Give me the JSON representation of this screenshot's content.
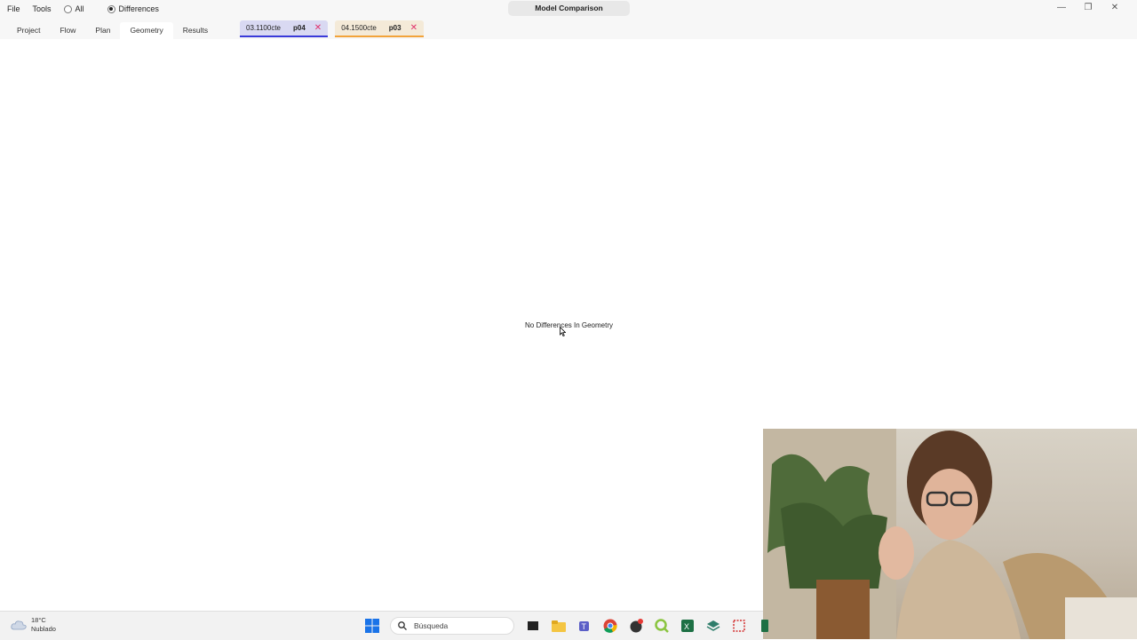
{
  "window": {
    "title": "Model Comparison",
    "controls": {
      "minimize": "—",
      "restore": "❐",
      "close": "✕"
    }
  },
  "menu": {
    "file": "File",
    "tools": "Tools"
  },
  "filter": {
    "all_label": "All",
    "differences_label": "Differences",
    "selected": "Differences"
  },
  "tabs": [
    {
      "label": "Project"
    },
    {
      "label": "Flow"
    },
    {
      "label": "Plan"
    },
    {
      "label": "Geometry",
      "active": true
    },
    {
      "label": "Results"
    }
  ],
  "models": [
    {
      "name": "03.1100cte",
      "code": "p04",
      "close": "✕",
      "color": "#3a3ad9"
    },
    {
      "name": "04.1500cte",
      "code": "p03",
      "close": "✕",
      "color": "#f2a33a"
    }
  ],
  "main": {
    "message": "No Differences In Geometry"
  },
  "taskbar": {
    "weather": {
      "temp": "18°C",
      "condition": "Nublado"
    },
    "search_placeholder": "Búsqueda",
    "apps": [
      "windows-start-icon",
      "search-icon",
      "task-view-icon",
      "file-explorer-icon",
      "teams-icon",
      "chrome-icon",
      "app-red-badge-icon",
      "qgis-icon",
      "excel-icon",
      "stack-icon",
      "snip-icon",
      "green-app-icon"
    ]
  }
}
